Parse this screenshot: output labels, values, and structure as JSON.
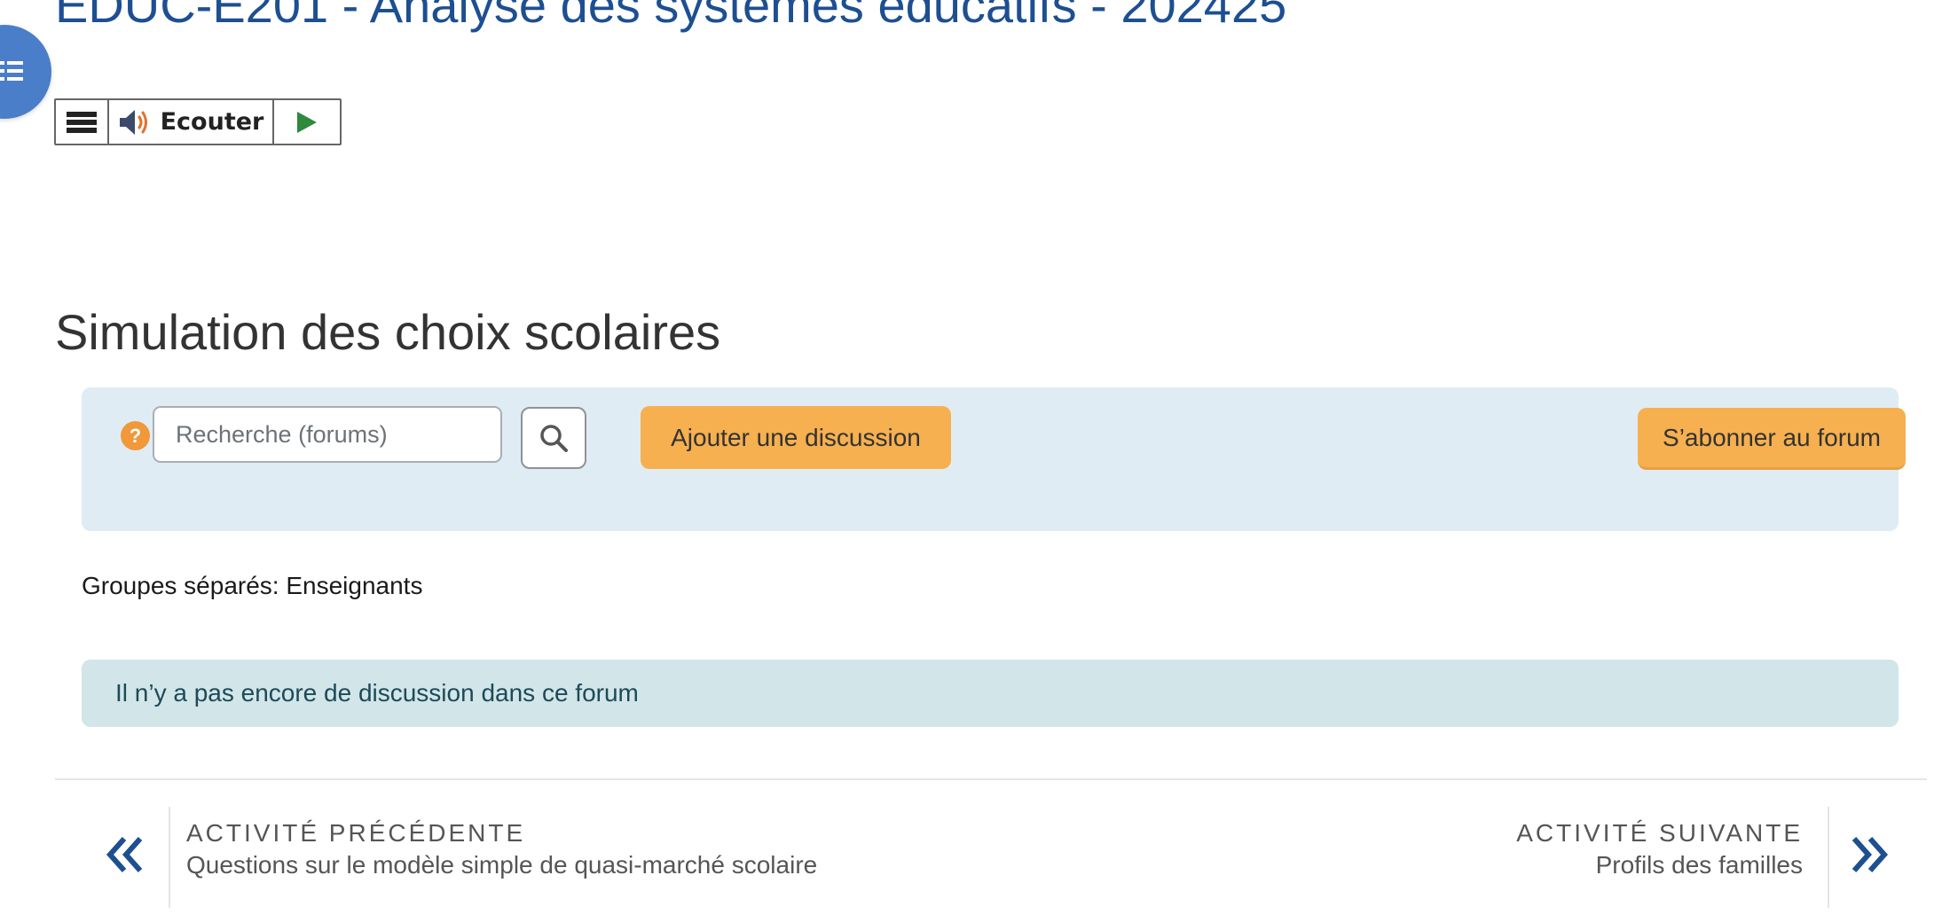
{
  "course": {
    "title": "EDUC-E201 - Analyse des systèmes éducatifs - 202425"
  },
  "drawer": {
    "icon": "list-icon"
  },
  "readspeaker": {
    "menu_icon": "hamburger-menu-icon",
    "speaker_icon": "speaker-icon",
    "listen_label": "Ecouter",
    "play_icon": "play-icon"
  },
  "activity": {
    "title": "Simulation des choix scolaires"
  },
  "forum_toolbar": {
    "help_icon": "question-mark-icon",
    "help_symbol": "?",
    "search_placeholder": "Recherche (forums)",
    "search_value": "",
    "search_button_icon": "search-icon",
    "add_discussion_label": "Ajouter une discussion",
    "subscribe_label": "S’abonner au forum"
  },
  "groups": {
    "text": "Groupes séparés: Enseignants"
  },
  "notice": {
    "text": "Il n’y a pas encore de discussion dans ce forum"
  },
  "activity_nav": {
    "previous": {
      "kicker": "Activité précédente",
      "name": "Questions sur le modèle simple de quasi-marché scolaire",
      "icon": "double-chevron-left-icon"
    },
    "next": {
      "kicker": "Activité suivante",
      "name": "Profils des familles",
      "icon": "double-chevron-right-icon"
    }
  },
  "colors": {
    "link_blue": "#1d4f91",
    "drawer_blue": "#4a7ec8",
    "accent_orange": "#f6b04f",
    "panel_bg": "#e0ecf4",
    "notice_bg": "#d2e5e9"
  }
}
